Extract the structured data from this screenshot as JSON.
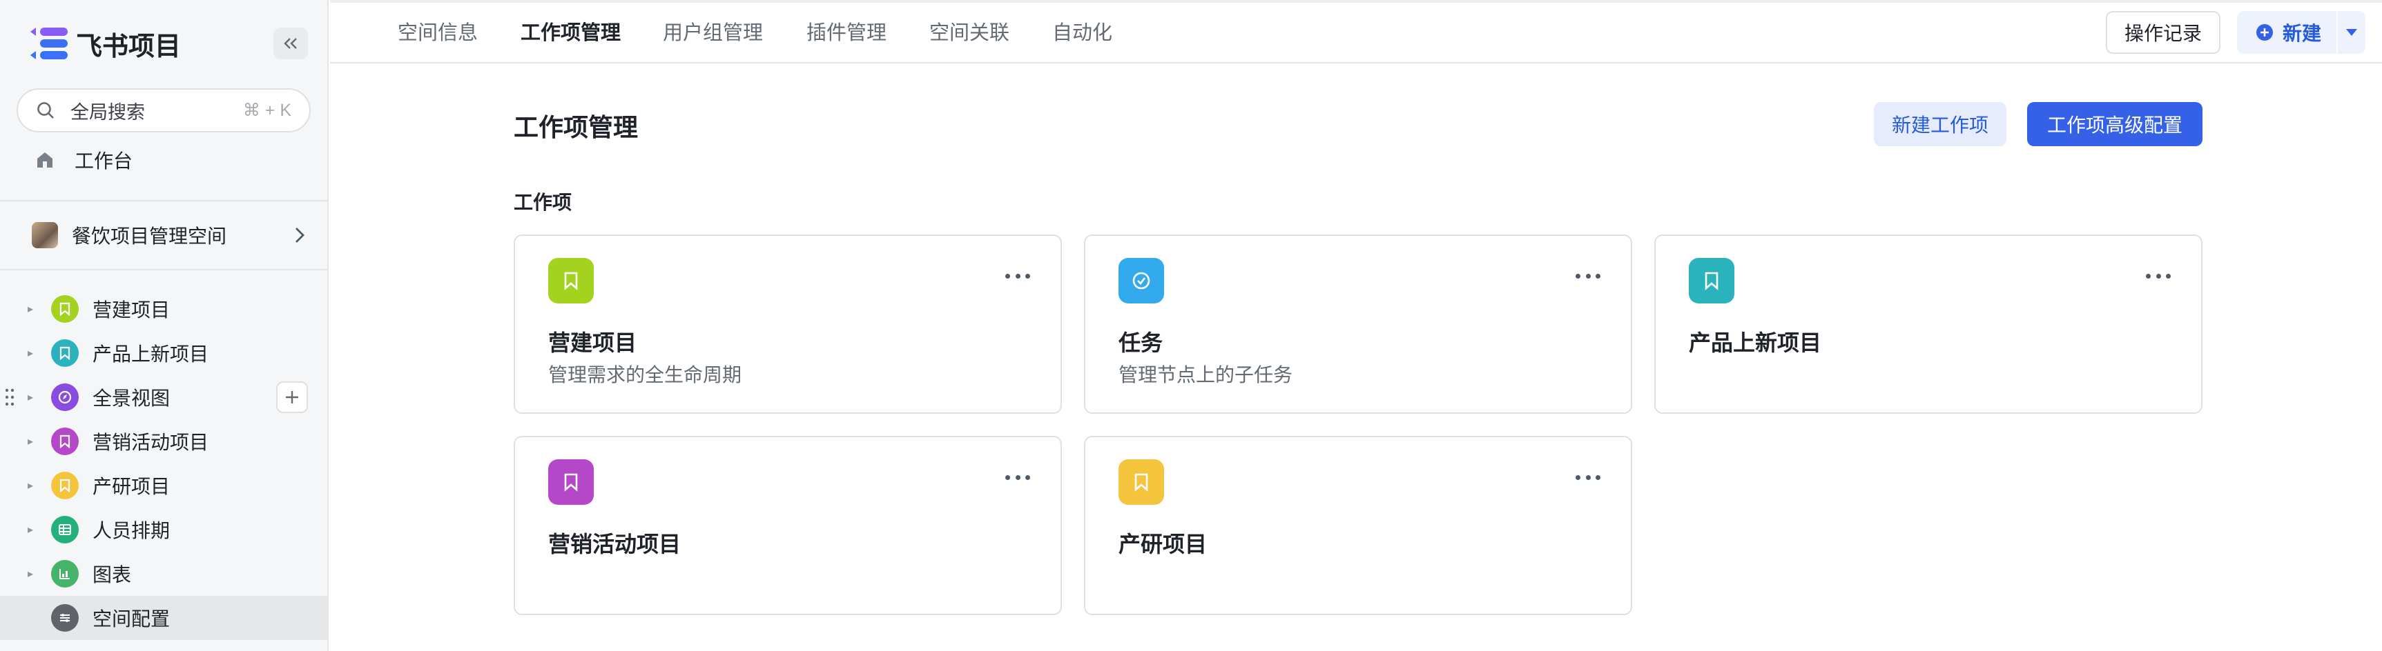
{
  "colors": {
    "accent": "#3461e8",
    "accent_text": "#245bdb",
    "sidebar_bg": "#f5f6f7",
    "card_border": "#dee0e3"
  },
  "brand": {
    "name": "飞书项目",
    "logo_icon": "feishu-project-logo"
  },
  "sidebar": {
    "search": {
      "placeholder": "全局搜索",
      "shortcut": "⌘ + K"
    },
    "home": {
      "label": "工作台",
      "icon": "home-icon"
    },
    "space": {
      "name": "餐饮项目管理空间"
    },
    "items": [
      {
        "label": "营建项目",
        "icon": "bookmark-icon",
        "color": "#a3d21f"
      },
      {
        "label": "产品上新项目",
        "icon": "bookmark-icon",
        "color": "#2ab3bd"
      },
      {
        "label": "全景视图",
        "icon": "compass-icon",
        "color": "#8a4be0"
      },
      {
        "label": "营销活动项目",
        "icon": "bookmark-icon",
        "color": "#b547c9"
      },
      {
        "label": "产研项目",
        "icon": "bookmark-icon",
        "color": "#f5c43d"
      },
      {
        "label": "人员排期",
        "icon": "table-icon",
        "color": "#23b07d"
      },
      {
        "label": "图表",
        "icon": "chart-icon",
        "color": "#46b36b"
      },
      {
        "label": "空间配置",
        "icon": "settings-icon",
        "color": "#5f646b"
      }
    ]
  },
  "tabs": [
    {
      "label": "空间信息",
      "active": false
    },
    {
      "label": "工作项管理",
      "active": true
    },
    {
      "label": "用户组管理",
      "active": false
    },
    {
      "label": "插件管理",
      "active": false
    },
    {
      "label": "空间关联",
      "active": false
    },
    {
      "label": "自动化",
      "active": false
    }
  ],
  "header_actions": {
    "log_label": "操作记录",
    "new_label": "新建"
  },
  "main": {
    "title": "工作项管理",
    "new_item_label": "新建工作项",
    "advanced_config_label": "工作项高级配置",
    "section_label": "工作项",
    "cards": [
      {
        "title": "营建项目",
        "description": "管理需求的全生命周期",
        "icon": "bookmark-icon",
        "color": "#a3d21f"
      },
      {
        "title": "任务",
        "description": "管理节点上的子任务",
        "icon": "check-circle-icon",
        "color": "#33a9ee"
      },
      {
        "title": "产品上新项目",
        "description": "",
        "icon": "bookmark-icon",
        "color": "#2ab3bd"
      },
      {
        "title": "营销活动项目",
        "description": "",
        "icon": "bookmark-icon",
        "color": "#b547c9"
      },
      {
        "title": "产研项目",
        "description": "",
        "icon": "bookmark-icon",
        "color": "#f5c43d"
      }
    ]
  }
}
